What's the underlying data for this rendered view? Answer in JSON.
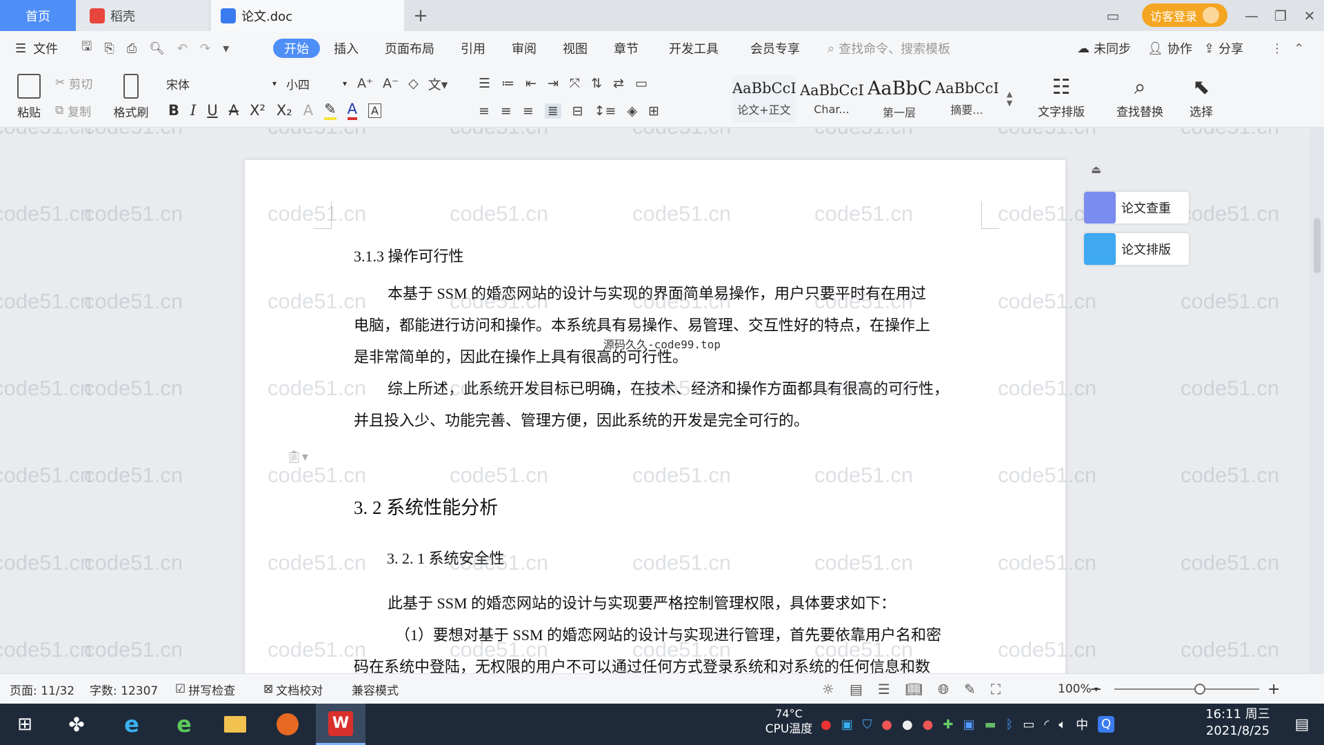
{
  "tabs": {
    "home": "首页",
    "daoke": "稻壳",
    "doc": "论文.doc",
    "add": "+"
  },
  "titlebar": {
    "login": "访客登录"
  },
  "menu": {
    "file": "文件",
    "items": [
      "开始",
      "插入",
      "页面布局",
      "引用",
      "审阅",
      "视图",
      "章节",
      "开发工具",
      "会员专享"
    ],
    "search_placeholder": "查找命令、搜索模板",
    "sync": "未同步",
    "collab": "协作",
    "share": "分享"
  },
  "ribbon": {
    "paste": "粘贴",
    "cut": "剪切",
    "copy": "复制",
    "format_painter": "格式刷",
    "font_name": "宋体",
    "font_size": "小四",
    "styles": [
      {
        "preview": "AaBbCcI",
        "label": "论文+正文"
      },
      {
        "preview": "AaBbCcDc",
        "label": "Char..."
      },
      {
        "preview": "AaBbC",
        "label": "第一层"
      },
      {
        "preview": "AaBbCcI",
        "label": "摘要..."
      }
    ],
    "text_layout": "文字排版",
    "find_replace": "查找替换",
    "select": "选择"
  },
  "document": {
    "heading_313": "3.1.3 操作可行性",
    "para1_line1": "本基于 SSM 的婚恋网站的设计与实现的界面简单易操作，用户只要平时有在用过",
    "para1_line2": "电脑，都能进行访问和操作。本系统具有易操作、易管理、交互性好的特点，在操作上",
    "para1_line3": "是非常简单的，因此在操作上具有很高的可行性。",
    "para2_line1": "综上所述，此系统开发目标已明确，在技术、经济和操作方面都具有很高的可行性，",
    "para2_line2": "并且投入少、功能完善、管理方便，因此系统的开发是完全可行的。",
    "heading_32": "3. 2 系统性能分析",
    "heading_321": "3. 2. 1  系统安全性",
    "para3": "此基于 SSM 的婚恋网站的设计与实现要严格控制管理权限，具体要求如下：",
    "para4_line1": "（1）要想对基于 SSM 的婚恋网站的设计与实现进行管理，首先要依靠用户名和密",
    "para4_line2": "码在系统中登陆，无权限的用户不可以通过任何方式登录系统和对系统的任何信息和数",
    "source_watermark": "源码久久-code99.top",
    "watermark": "code51.cn"
  },
  "side_panel": {
    "check": "论文查重",
    "layout": "论文排版"
  },
  "statusbar": {
    "page": "页面: 11/32",
    "words": "字数: 12307",
    "spell": "拼写检查",
    "proof": "文档校对",
    "compat": "兼容模式",
    "zoom": "100%",
    "zoom_level": 100
  },
  "taskbar": {
    "cpu_temp": "74°C",
    "cpu_label": "CPU温度",
    "ime": "中",
    "time": "16:11 周三",
    "date": "2021/8/25"
  },
  "colors": {
    "accent": "#4e8ef7",
    "login": "#f4a521",
    "wps_red": "#d9302c"
  }
}
